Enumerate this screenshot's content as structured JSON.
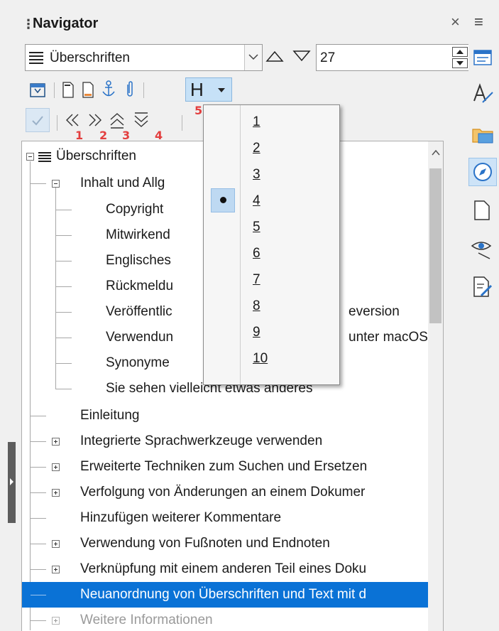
{
  "navigator": {
    "title": "Navigator",
    "close_glyph": "×",
    "menu_glyph": "≡",
    "category_combo": {
      "value": "Überschriften"
    },
    "position_spin": {
      "value": "27"
    }
  },
  "toolbar": {
    "heading_button_label": "H",
    "markers": [
      "1",
      "2",
      "3",
      "4",
      "5"
    ]
  },
  "tree": {
    "root": "Überschriften",
    "items": [
      "Inhalt und Allg",
      "Copyright",
      "Mitwirkend",
      "Englisches",
      "Rückmeldu",
      "Veröffentlic",
      "Verwendun",
      "Synonyme",
      "Sie sehen vielleicht etwas anderes",
      "Einleitung",
      "Integrierte Sprachwerkzeuge verwenden",
      "Erweiterte Techniken zum Suchen und Ersetzen",
      "Verfolgung von Änderungen an einem Dokumer",
      "Hinzufügen weiterer Kommentare",
      "Verwendung von Fußnoten und Endnoten",
      "Verknüpfung mit einem anderen Teil eines Doku",
      "Neuanordnung von Überschriften und Text mit d",
      "Weitere Informationen"
    ],
    "tail_veroeffentlic": "eversion",
    "tail_verwendun": "unter macOS"
  },
  "heading_levels_menu": {
    "items": [
      "1",
      "2",
      "3",
      "4",
      "5",
      "6",
      "7",
      "8",
      "9",
      "10"
    ],
    "checked_index": 3
  },
  "colors": {
    "selection": "#0a72d6",
    "accent_marker": "#e33e3e",
    "hover_button": "#c6e1f7"
  }
}
